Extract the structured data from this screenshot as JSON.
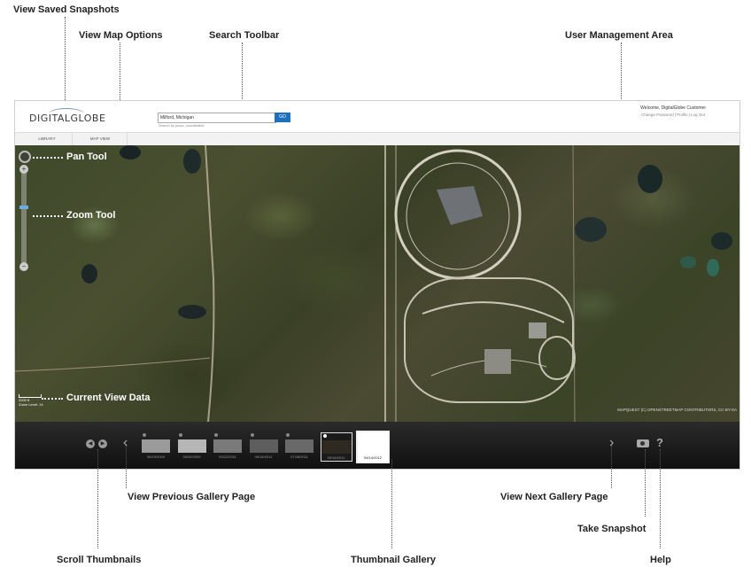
{
  "callouts": {
    "view_saved_snapshots": "View Saved Snapshots",
    "view_map_options": "View Map Options",
    "search_toolbar": "Search Toolbar",
    "user_management_area": "User Management Area",
    "pan_tool": "Pan Tool",
    "zoom_tool": "Zoom Tool",
    "current_view_data": "Current View Data",
    "view_previous_gallery_page": "View Previous Gallery Page",
    "view_next_gallery_page": "View Next Gallery Page",
    "take_snapshot": "Take Snapshot",
    "scroll_thumbnails": "Scroll Thumbnails",
    "thumbnail_gallery": "Thumbnail Gallery",
    "help": "Help"
  },
  "header": {
    "logo": "DIGITALGLOBE",
    "search": {
      "value": "Milford, Michigan",
      "go_label": "GO",
      "hint": "Search by place, coordinates"
    },
    "user": {
      "welcome": "Welcome, DigitalGlobe Customer",
      "links": [
        "Change Password",
        "Profile",
        "Log Out"
      ]
    }
  },
  "tabs": {
    "library": "LIBRARY",
    "map_view": "MAP VIEW"
  },
  "map": {
    "scale_label": "2000 ft",
    "view_info": "Zoom Level: 14",
    "attribution": "MAPQUEST (C) OPENSTREETMAP CONTRIBUTORS, CC-BY-SA",
    "zoom_level": 0.62
  },
  "gallery": {
    "prev_icon": "chevron-left-icon",
    "next_icon": "chevron-right-icon",
    "thumbnails": [
      {
        "date": "08/19/2009",
        "color": "#9b9b9b",
        "state": "normal"
      },
      {
        "date": "09/26/2009",
        "color": "#b6b6b6",
        "state": "normal"
      },
      {
        "date": "09/22/2011",
        "color": "#7a7a7a",
        "state": "normal"
      },
      {
        "date": "09/18/2011",
        "color": "#5e5e5e",
        "state": "normal"
      },
      {
        "date": "07/28/2011",
        "color": "#696969",
        "state": "normal"
      },
      {
        "date": "09/18/2011",
        "color": "#2e2a22",
        "state": "active"
      },
      {
        "date": "09/14/2012",
        "color": "#ffffff",
        "state": "selected"
      }
    ],
    "camera_icon": "camera-icon",
    "help_icon": "help-icon",
    "help_glyph": "?"
  }
}
